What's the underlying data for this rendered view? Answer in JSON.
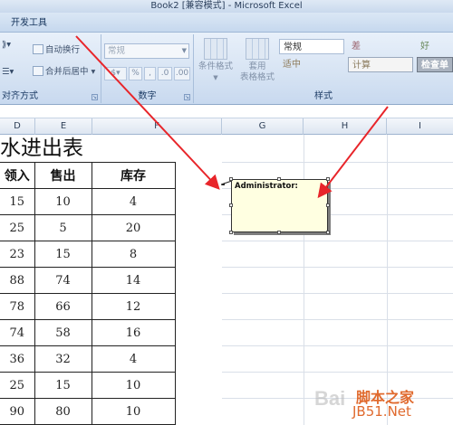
{
  "window": {
    "title": "Book2  [兼容模式] - Microsoft Excel"
  },
  "ribbon": {
    "tab_label": "开发工具",
    "alignment": {
      "group_label": "对齐方式",
      "wrap_text": "自动换行",
      "merge_center": "合并后居中"
    },
    "number": {
      "group_label": "数字",
      "format_value": "常规",
      "percent": "%",
      "comma": ",",
      "inc_decimal": ".0",
      "dec_decimal": ".00"
    },
    "styles": {
      "group_label": "样式",
      "conditional_format": "条件格式",
      "format_as_table_line1": "套用",
      "format_as_table_line2": "表格格式",
      "normal": "常规",
      "bad": "差",
      "good": "好",
      "neutral": "适中",
      "calculation": "计算",
      "check_cell": "检查单"
    }
  },
  "column_headers": [
    "D",
    "E",
    "F",
    "G",
    "H",
    "I"
  ],
  "sheet": {
    "title": "水进出表",
    "headers": [
      "领入",
      "售出",
      "库存"
    ],
    "rows": [
      [
        "15",
        "10",
        "4"
      ],
      [
        "25",
        "5",
        "20"
      ],
      [
        "23",
        "15",
        "8"
      ],
      [
        "88",
        "74",
        "14"
      ],
      [
        "78",
        "66",
        "12"
      ],
      [
        "74",
        "58",
        "16"
      ],
      [
        "36",
        "32",
        "4"
      ],
      [
        "25",
        "15",
        "10"
      ],
      [
        "90",
        "80",
        "10"
      ]
    ]
  },
  "comment": {
    "author": "Administrator:"
  },
  "watermark": {
    "site_name": "脚本之家",
    "url": "JB51.Net"
  },
  "colors": {
    "annotation_arrow": "#e8252a",
    "comment_bg": "#ffffe1"
  }
}
